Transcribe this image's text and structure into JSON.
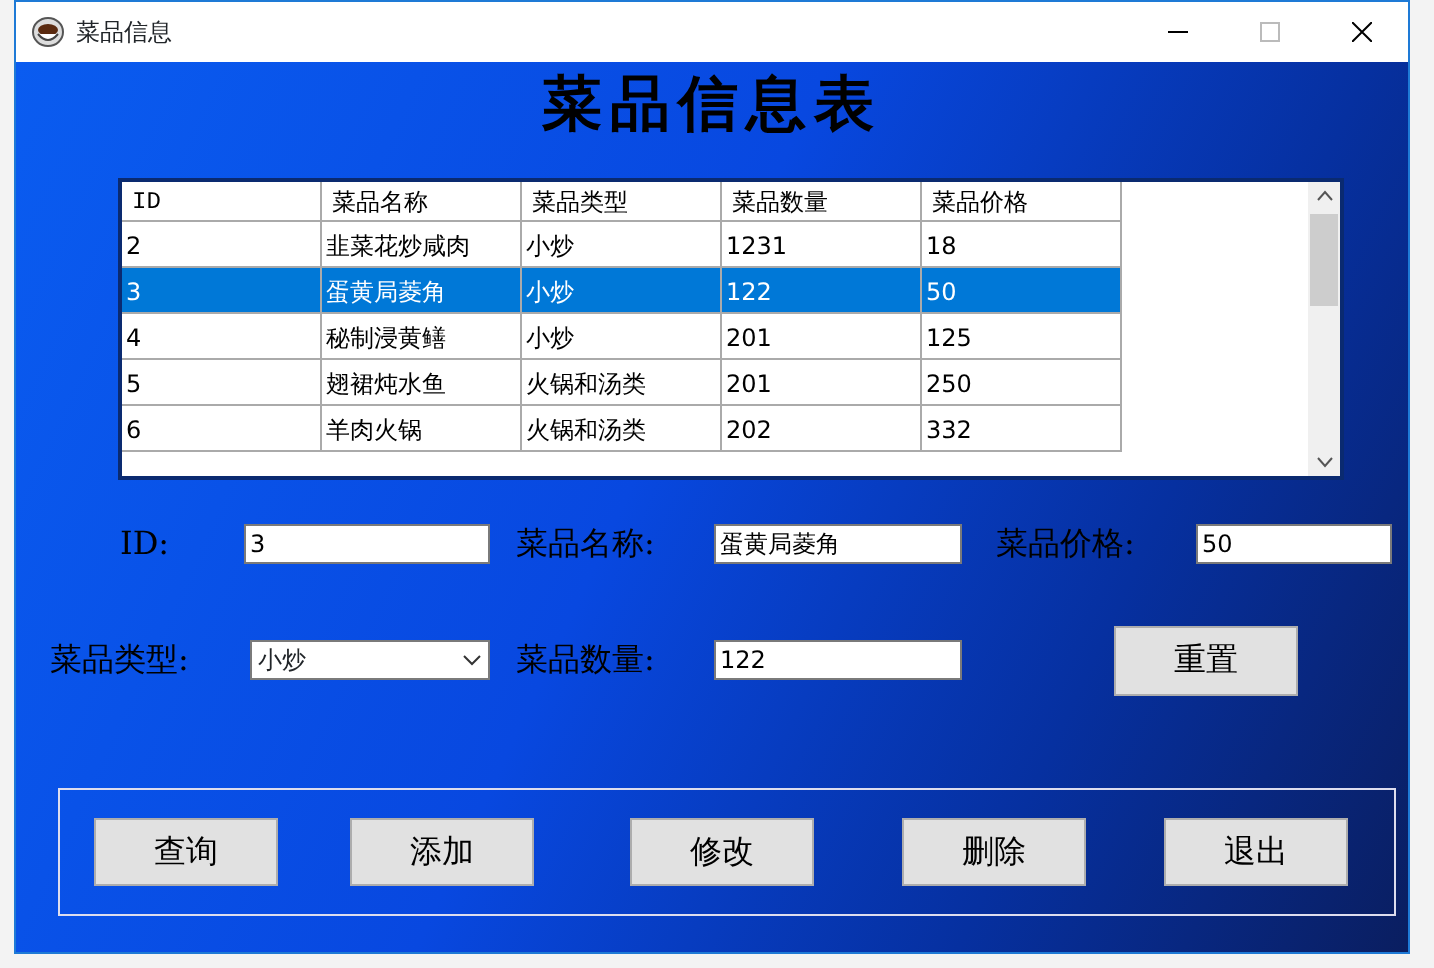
{
  "window": {
    "title": "菜品信息"
  },
  "heading": "菜品信息表",
  "table": {
    "columns": [
      "ID",
      "菜品名称",
      "菜品类型",
      "菜品数量",
      "菜品价格"
    ],
    "rows": [
      {
        "cells": [
          "2",
          "韭菜花炒咸肉",
          "小炒",
          "1231",
          "18"
        ],
        "selected": false
      },
      {
        "cells": [
          "3",
          "蛋黄局菱角",
          "小炒",
          "122",
          "50"
        ],
        "selected": true
      },
      {
        "cells": [
          "4",
          "秘制浸黄鳝",
          "小炒",
          "201",
          "125"
        ],
        "selected": false
      },
      {
        "cells": [
          "5",
          "翅裙炖水鱼",
          "火锅和汤类",
          "201",
          "250"
        ],
        "selected": false
      },
      {
        "cells": [
          "6",
          "羊肉火锅",
          "火锅和汤类",
          "202",
          "332"
        ],
        "selected": false
      }
    ]
  },
  "form_rows": [
    [
      {
        "label": "ID:",
        "kind": "text",
        "value": "3"
      },
      {
        "label": "菜品名称:",
        "kind": "text",
        "value": "蛋黄局菱角"
      },
      {
        "label": "菜品价格:",
        "kind": "text",
        "value": "50"
      }
    ],
    [
      {
        "label": "菜品类型:",
        "kind": "select",
        "value": "小炒"
      },
      {
        "label": "菜品数量:",
        "kind": "text",
        "value": "122"
      }
    ]
  ],
  "reset_button": "重置",
  "buttons": [
    "查询",
    "添加",
    "修改",
    "删除",
    "退出"
  ]
}
